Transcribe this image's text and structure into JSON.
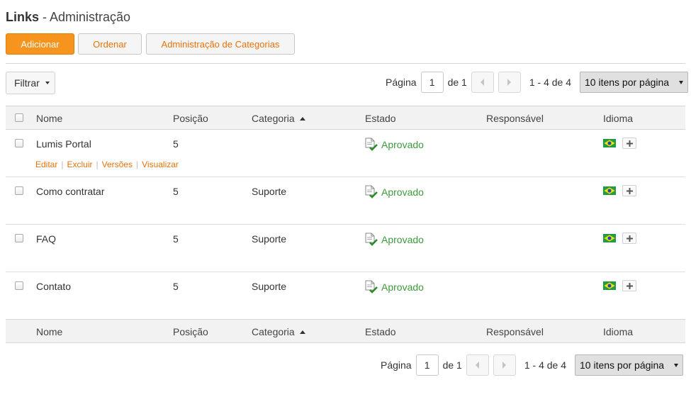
{
  "header": {
    "title_bold": "Links",
    "title_sub": " - Administração"
  },
  "toolbar": {
    "add_label": "Adicionar",
    "order_label": "Ordenar",
    "categories_label": "Administração de Categorias"
  },
  "filter": {
    "label": "Filtrar"
  },
  "pager": {
    "page_label": "Página",
    "page_value": "1",
    "of_label": "de 1",
    "range": "1 - 4 de 4",
    "per_page": "10 itens por página"
  },
  "table": {
    "columns": {
      "name": "Nome",
      "position": "Posição",
      "category": "Categoria",
      "status": "Estado",
      "owner": "Responsável",
      "language": "Idioma"
    },
    "row_actions": {
      "edit": "Editar",
      "delete": "Excluir",
      "versions": "Versões",
      "view": "Visualizar"
    },
    "rows": [
      {
        "name": "Lumis Portal",
        "position": "5",
        "category": "",
        "status": "Aprovado",
        "owner": ""
      },
      {
        "name": "Como contratar",
        "position": "5",
        "category": "Suporte",
        "status": "Aprovado",
        "owner": ""
      },
      {
        "name": "FAQ",
        "position": "5",
        "category": "Suporte",
        "status": "Aprovado",
        "owner": ""
      },
      {
        "name": "Contato",
        "position": "5",
        "category": "Suporte",
        "status": "Aprovado",
        "owner": ""
      }
    ]
  },
  "icons": {
    "status": "document-check-icon",
    "flag": "brazil-flag-icon",
    "add_language": "plus-icon"
  },
  "colors": {
    "accent": "#f7941d",
    "link": "#e8720c",
    "approved": "#3c9a3c"
  }
}
